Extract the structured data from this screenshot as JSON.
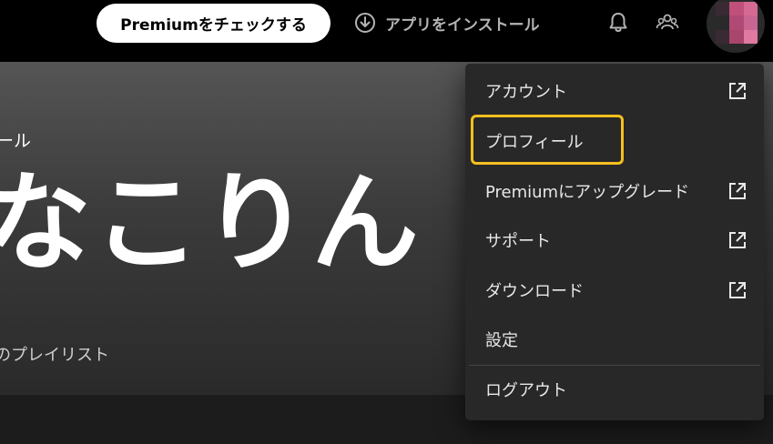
{
  "topbar": {
    "premium_button": "Premiumをチェックする",
    "install_app": "アプリをインストール",
    "icons": {
      "download": "download-circle-icon",
      "notifications": "bell-icon",
      "friends": "friends-activity-icon",
      "avatar": "user-avatar"
    },
    "avatar_colors": [
      "#3a2a33",
      "#c0507a",
      "#d46a94",
      "#2a2a2a",
      "#b04a75",
      "#c86590",
      "#3a2a33",
      "#a8466c",
      "#e07aa2"
    ]
  },
  "hero": {
    "type_label": "ール",
    "name": "なこりん",
    "subtitle": "のプレイリスト"
  },
  "menu": {
    "items": [
      {
        "label": "アカウント",
        "external": true
      },
      {
        "label": "プロフィール",
        "external": false
      },
      {
        "label": "Premiumにアップグレード",
        "external": true
      },
      {
        "label": "サポート",
        "external": true
      },
      {
        "label": "ダウンロード",
        "external": true
      },
      {
        "label": "設定",
        "external": false
      },
      {
        "label": "ログアウト",
        "external": false
      }
    ],
    "highlight_color": "#f5bf1f"
  }
}
